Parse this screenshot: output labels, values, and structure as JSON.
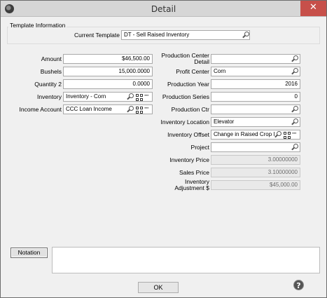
{
  "window": {
    "title": "Detail",
    "close_symbol": "✕"
  },
  "template": {
    "legend": "Template Information",
    "label": "Current Template",
    "value": "DT - Sell Raised Inventory"
  },
  "left_fields": {
    "amount": {
      "label": "Amount",
      "value": "$46,500.00"
    },
    "bushels": {
      "label": "Bushels",
      "value": "15,000.0000"
    },
    "quantity2": {
      "label": "Quantity 2",
      "value": "0.0000"
    },
    "inventory": {
      "label": "Inventory",
      "value": "Inventory -  Corn"
    },
    "income_account": {
      "label": "Income Account",
      "value": "CCC Loan Income"
    }
  },
  "right_fields": {
    "production_center_detail": {
      "label_line1": "Production Center",
      "label_line2": "Detail",
      "value": ""
    },
    "profit_center": {
      "label": "Profit Center",
      "value": "Corn"
    },
    "production_year": {
      "label": "Production Year",
      "value": "2016"
    },
    "production_series": {
      "label": "Production Series",
      "value": "0"
    },
    "production_ctr": {
      "label": "Production Ctr",
      "value": ""
    },
    "inventory_location": {
      "label": "Inventory Location",
      "value": "Elevator"
    },
    "inventory_offset": {
      "label": "Inventory Offset",
      "value": "Change in Raised Crop I"
    },
    "project": {
      "label": "Project",
      "value": ""
    },
    "inventory_price": {
      "label": "Inventory Price",
      "value": "3.00000000"
    },
    "sales_price": {
      "label": "Sales Price",
      "value": "3.10000000"
    },
    "inventory_adjustment": {
      "label_line1": "Inventory",
      "label_line2": "Adjustment $",
      "value": "$45,000.00"
    }
  },
  "notation": {
    "button_label": "Notation",
    "text": ""
  },
  "footer": {
    "ok_label": "OK",
    "help_symbol": "?"
  },
  "icons": [
    "app-icon",
    "close-icon",
    "search-icon",
    "grid-icon",
    "ellipsis-icon",
    "help-icon"
  ]
}
